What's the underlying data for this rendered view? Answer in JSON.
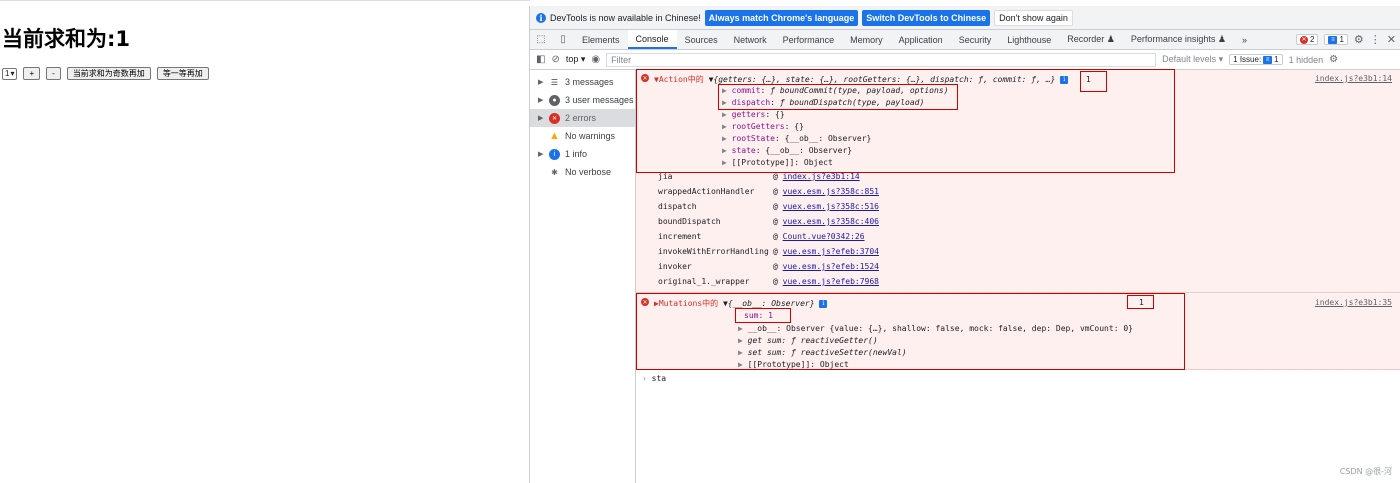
{
  "page": {
    "heading": "当前求和为:1",
    "select_value": "1",
    "buttons": [
      "+",
      "-",
      "当前求和为奇数再加",
      "等一等再加"
    ]
  },
  "devtools": {
    "infobar": {
      "text": "DevTools is now available in Chinese!",
      "btn_match": "Always match Chrome's language",
      "btn_switch": "Switch DevTools to Chinese",
      "btn_dismiss": "Don't show again"
    },
    "tabs": [
      "Elements",
      "Console",
      "Sources",
      "Network",
      "Performance",
      "Memory",
      "Application",
      "Security",
      "Lighthouse",
      "Recorder ♟",
      "Performance insights ♟"
    ],
    "more_tabs": "»",
    "error_count": "2",
    "info_count": "1",
    "toolbar": {
      "context": "top ▾",
      "filter_placeholder": "Filter",
      "levels": "Default levels ▾",
      "issues": "1 Issue:",
      "issues_count": "1",
      "hidden": "1 hidden"
    },
    "sidebar": [
      {
        "label": "3 messages",
        "icon": "list-icon"
      },
      {
        "label": "3 user messages",
        "icon": "user-icon"
      },
      {
        "label": "2 errors",
        "icon": "error-icon"
      },
      {
        "label": "No warnings",
        "icon": "warning-icon"
      },
      {
        "label": "1 info",
        "icon": "info-icon"
      },
      {
        "label": "No verbose",
        "icon": "bug-icon"
      }
    ],
    "console": {
      "msg1": {
        "label": "Action中的",
        "summary": "{getters: {…}, state: {…}, rootGetters: {…}, dispatch: ƒ, commit: ƒ, …}",
        "value": "1",
        "source": "index.js?e3b1:14",
        "props": [
          {
            "key": "commit",
            "val": "ƒ boundCommit(type, payload, options)"
          },
          {
            "key": "dispatch",
            "val": "ƒ boundDispatch(type, payload)"
          },
          {
            "key": "getters",
            "val": "{}"
          },
          {
            "key": "rootGetters",
            "val": "{}"
          },
          {
            "key": "rootState",
            "val": "{__ob__: Observer}"
          },
          {
            "key": "state",
            "val": "{__ob__: Observer}"
          },
          {
            "key": "[[Prototype]]",
            "val": "Object"
          }
        ],
        "stack": [
          {
            "fn": "jia",
            "loc": "index.js?e3b1:14"
          },
          {
            "fn": "wrappedActionHandler",
            "loc": "vuex.esm.js?358c:851"
          },
          {
            "fn": "dispatch",
            "loc": "vuex.esm.js?358c:516"
          },
          {
            "fn": "boundDispatch",
            "loc": "vuex.esm.js?358c:406"
          },
          {
            "fn": "increment",
            "loc": "Count.vue?0342:26"
          },
          {
            "fn": "invokeWithErrorHandling",
            "loc": "vue.esm.js?efeb:3704"
          },
          {
            "fn": "invoker",
            "loc": "vue.esm.js?efeb:1524"
          },
          {
            "fn": "original_1._wrapper",
            "loc": "vue.esm.js?efeb:7968"
          }
        ]
      },
      "msg2": {
        "label": "Mutations中的",
        "summary": "{__ob__: Observer}",
        "value": "1",
        "source": "index.js?e3b1:35",
        "sum": "sum: 1",
        "ob_line": "__ob__: Observer {value: {…}, shallow: false, mock: false, dep: Dep, vmCount: 0}",
        "get_line": "get sum: ƒ reactiveGetter()",
        "set_line": "set sum: ƒ reactiveSetter(newVal)",
        "proto_line": "[[Prototype]]: Object"
      },
      "prompt_input": "sta"
    },
    "watermark": "CSDN @很-河"
  }
}
